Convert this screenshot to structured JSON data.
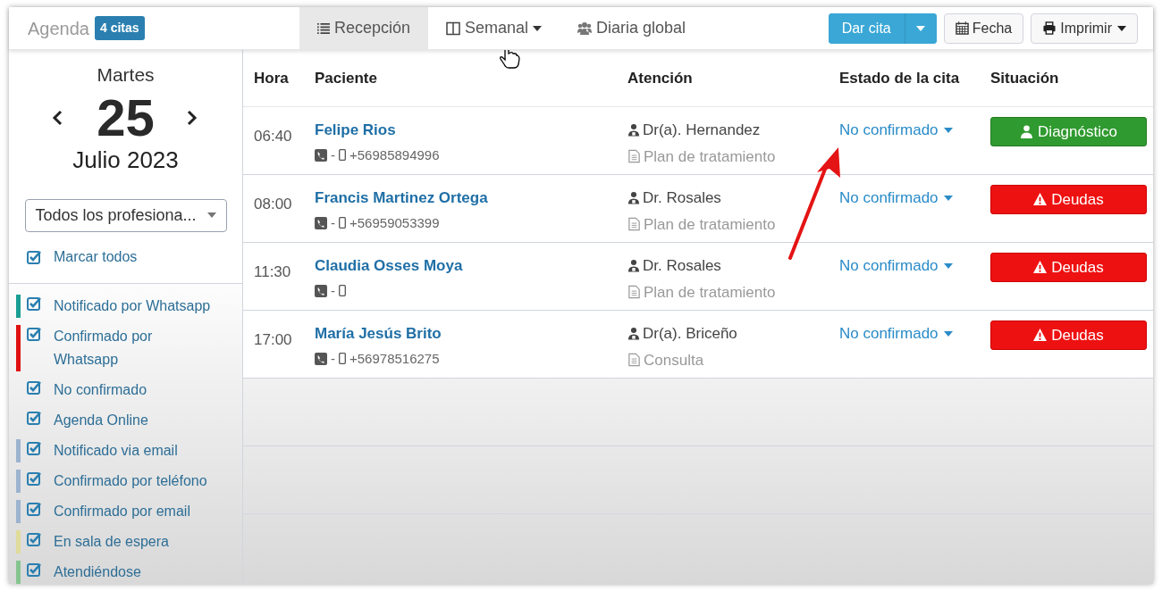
{
  "header": {
    "title": "Agenda",
    "badge": "4 citas"
  },
  "tabs": [
    {
      "label": "Recepción",
      "selected": true,
      "kind": "list",
      "dropdown": false
    },
    {
      "label": "Semanal",
      "selected": false,
      "kind": "columns",
      "dropdown": true
    },
    {
      "label": "Diaria global",
      "selected": false,
      "kind": "users",
      "dropdown": false
    }
  ],
  "actions": [
    {
      "label": "Dar cita",
      "kind": "split"
    },
    {
      "label": "Fecha",
      "kind": "calendar"
    },
    {
      "label": "Imprimir",
      "kind": "print"
    }
  ],
  "date": {
    "weekday": "Martes",
    "day": "25",
    "month_year": "Julio 2023"
  },
  "professional_select": {
    "value": "Todos los profesiona..."
  },
  "mark_all": {
    "label": "Marcar todos",
    "checked": true
  },
  "statuses": [
    {
      "label": "Notificado por Whatsapp",
      "checked": true,
      "color": "#1a9e94"
    },
    {
      "label": "Confirmado por Whatsapp",
      "checked": true,
      "color": "#e01010"
    },
    {
      "label": "No confirmado",
      "checked": true
    },
    {
      "label": "Agenda Online",
      "checked": true
    },
    {
      "label": "Notificado via email",
      "checked": true,
      "color": "#9db3cf"
    },
    {
      "label": "Confirmado por teléfono",
      "checked": true,
      "color": "#9db3cf"
    },
    {
      "label": "Confirmado por email",
      "checked": true,
      "color": "#9db3cf"
    },
    {
      "label": "En sala de espera",
      "checked": true,
      "color": "#e0dc9a"
    },
    {
      "label": "Atendiéndose",
      "checked": true,
      "color": "#86c48e"
    }
  ],
  "table": {
    "columns": [
      "Hora",
      "Paciente",
      "Atención",
      "Estado de la cita",
      "Situación"
    ],
    "rows": [
      {
        "time": "06:40",
        "patient": "Felipe Rios",
        "landline": "-",
        "mobile": "+56985894996",
        "doctor": "Dr(a). Hernandez",
        "service": "Plan de tratamiento",
        "status": "No confirmado",
        "situation": {
          "label": "Diagnóstico",
          "kind": "diagnosis"
        }
      },
      {
        "time": "08:00",
        "patient": "Francis Martinez Ortega",
        "landline": "-",
        "mobile": "+56959053399",
        "doctor": "Dr. Rosales",
        "service": "Plan de tratamiento",
        "status": "No confirmado",
        "situation": {
          "label": "Deudas",
          "kind": "debt"
        }
      },
      {
        "time": "11:30",
        "patient": "Claudia Osses Moya",
        "landline": "-",
        "doctor": "Dr. Rosales",
        "service": "Plan de tratamiento",
        "status": "No confirmado",
        "situation": {
          "label": "Deudas",
          "kind": "debt"
        }
      },
      {
        "time": "17:00",
        "patient": "María Jesús Brito",
        "landline": "-",
        "mobile": "+56978516275",
        "doctor": "Dr(a). Briceño",
        "service": "Consulta",
        "status": "No confirmado",
        "situation": {
          "label": "Deudas",
          "kind": "debt"
        }
      }
    ]
  }
}
